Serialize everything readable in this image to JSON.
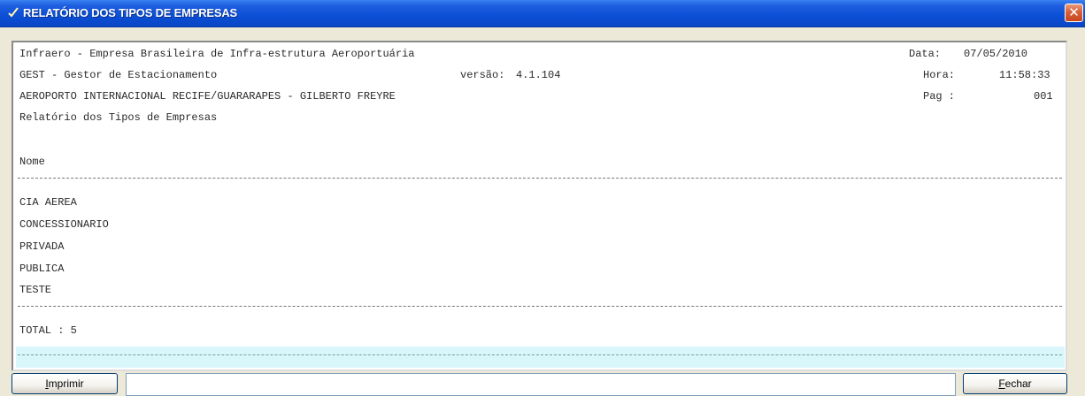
{
  "window": {
    "title": "RELATÓRIO DOS TIPOS DE EMPRESAS",
    "close_glyph": "✕"
  },
  "report": {
    "header": {
      "line1_left": "Infraero - Empresa Brasileira de Infra-estrutura Aeroportuária",
      "data_label": "Data:",
      "data_value": "07/05/2010",
      "line2_left": "GEST - Gestor de Estacionamento",
      "versao_label": "versão:",
      "versao_value": "4.1.104",
      "hora_label": "Hora:",
      "hora_value": "11:58:33",
      "line3_left": "AEROPORTO INTERNACIONAL RECIFE/GUARARAPES - GILBERTO FREYRE",
      "pag_label": "Pag :",
      "pag_value": "001",
      "line4_left": "Relatório dos Tipos de Empresas"
    },
    "column_header": "Nome",
    "rows": [
      "CIA AEREA",
      "CONCESSIONARIO",
      "PRIVADA",
      "PUBLICA",
      "TESTE"
    ],
    "total": "TOTAL : 5"
  },
  "footer": {
    "print_label_prefix": "I",
    "print_label_rest": "mprimir",
    "close_label_prefix": "F",
    "close_label_rest": "echar"
  },
  "colors": {
    "titlebar": "#0b4fd6",
    "highlight_row": "#d9f7fb",
    "close_button": "#d8603a"
  },
  "icons": {
    "title": "check-icon",
    "close": "close-icon"
  }
}
